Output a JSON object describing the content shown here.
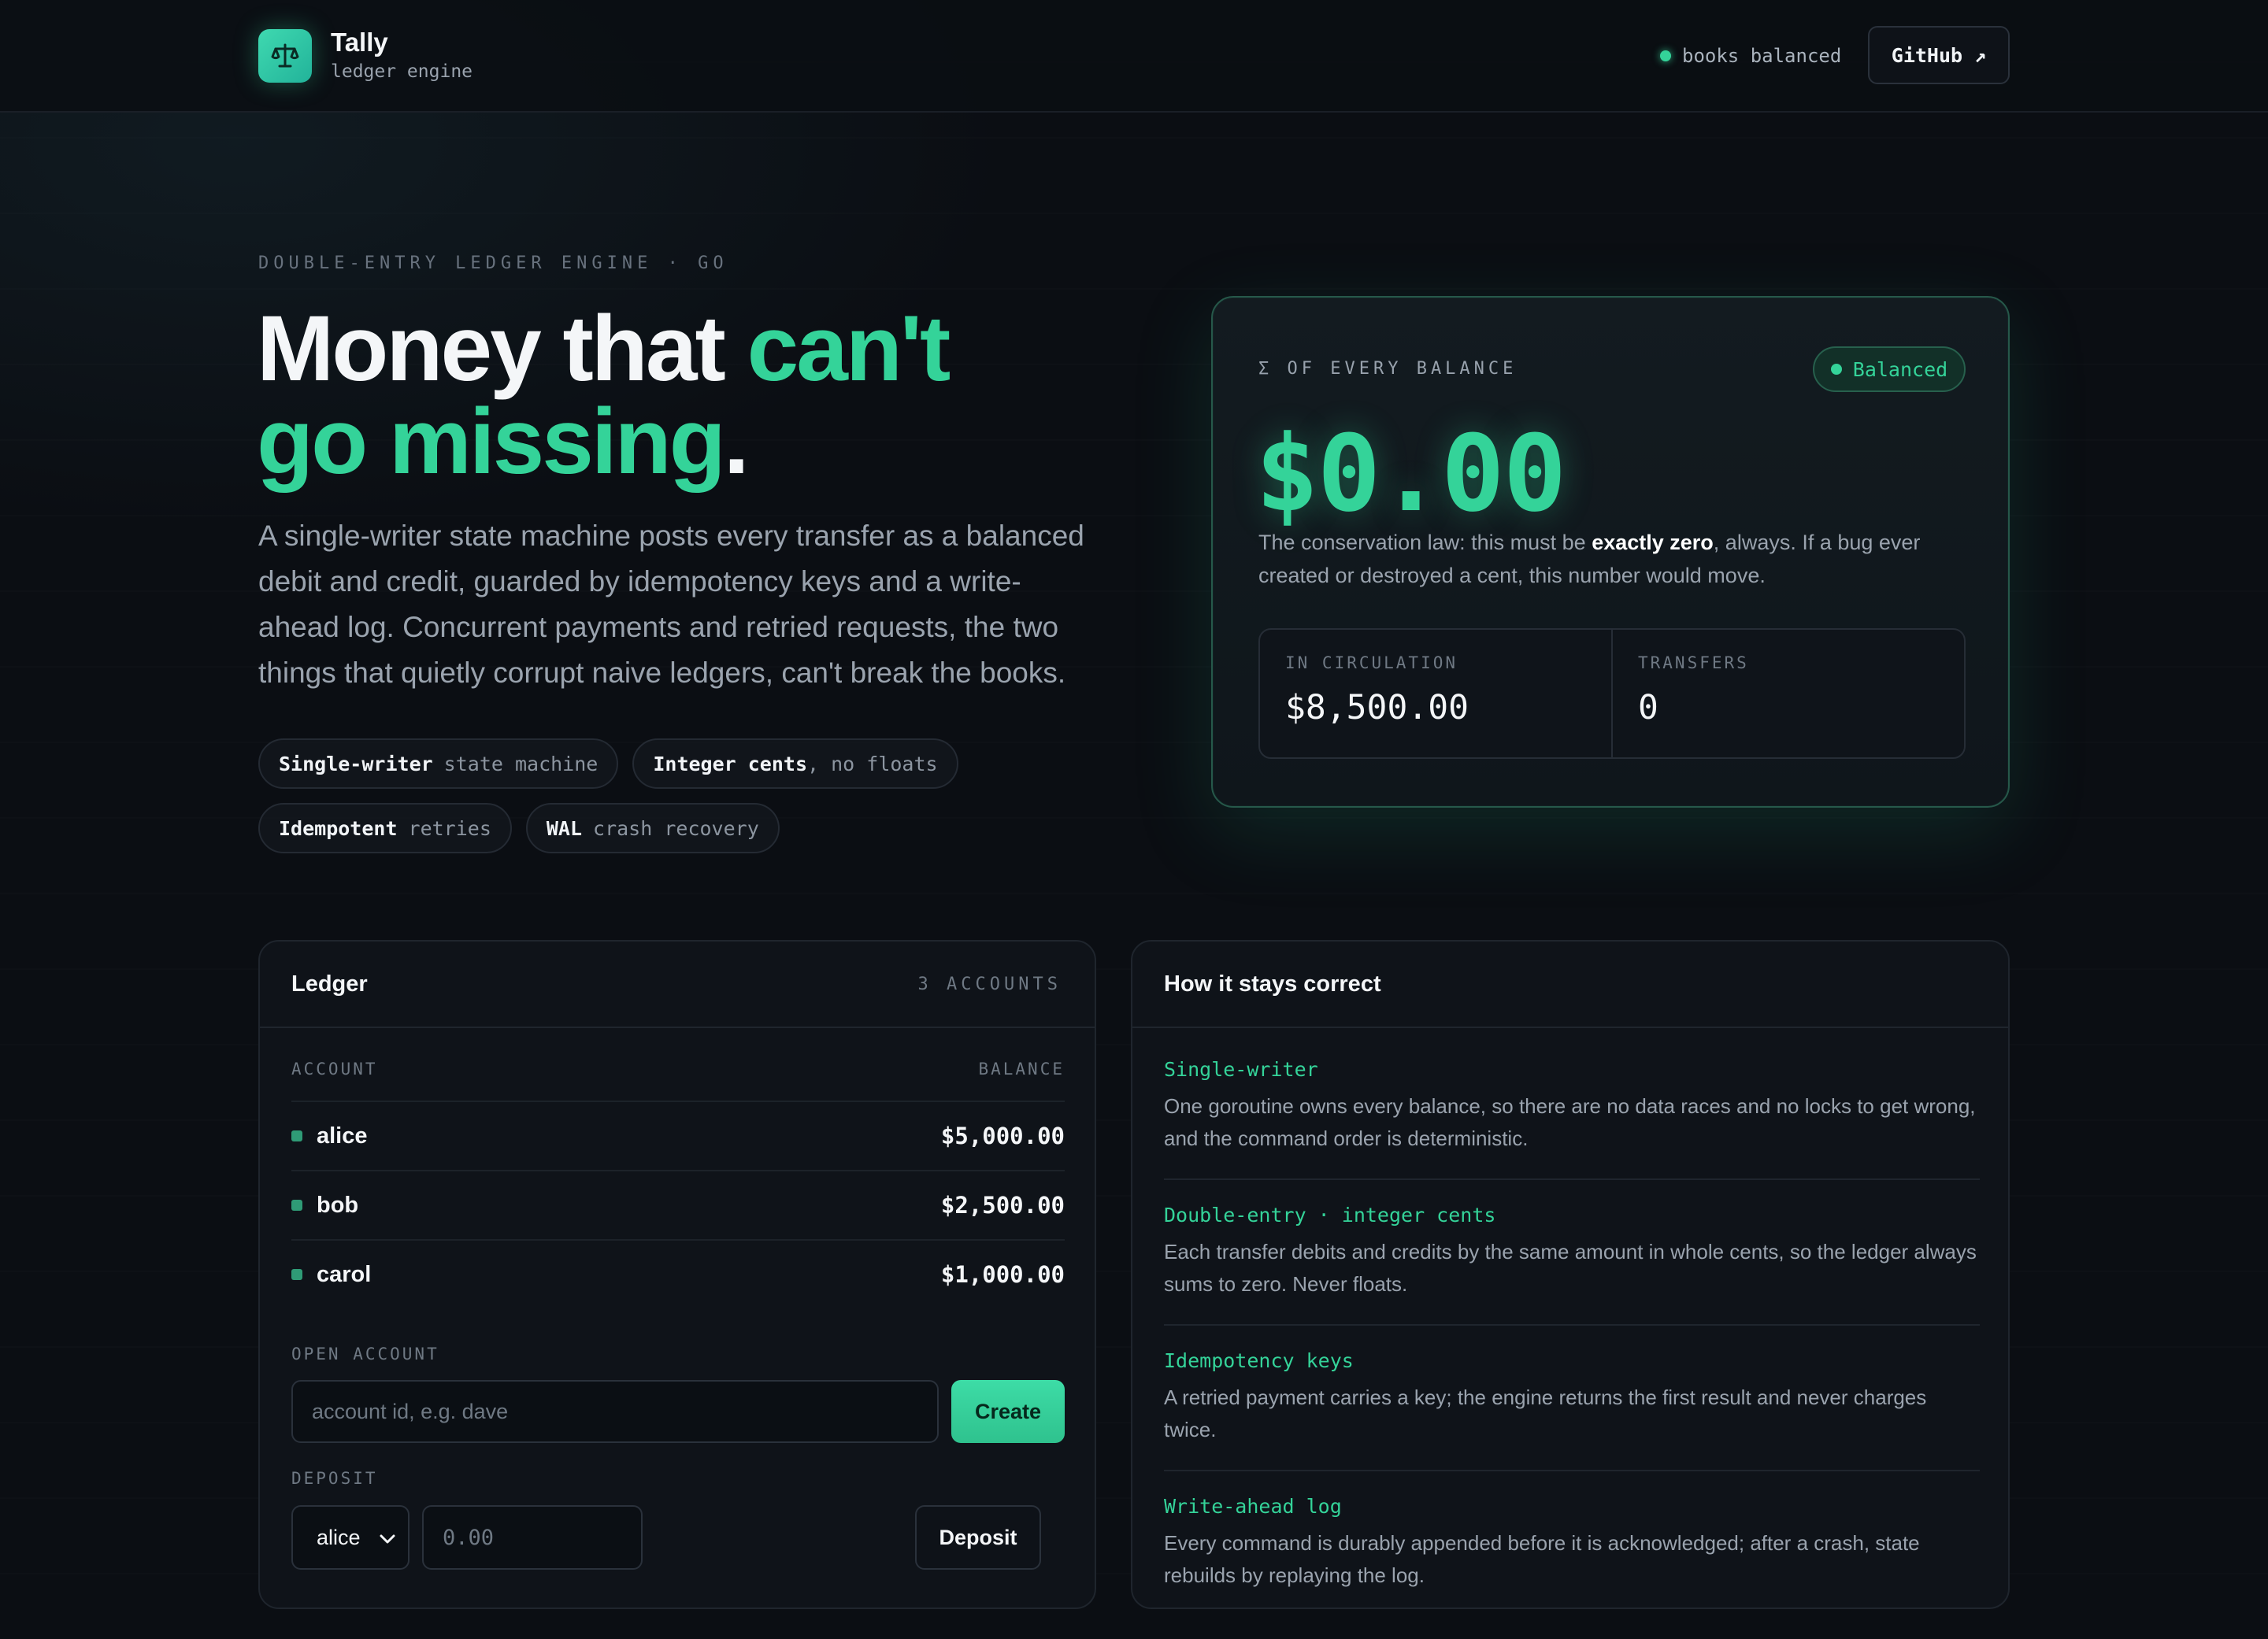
{
  "header": {
    "brand_name": "Tally",
    "brand_sub": "ledger engine",
    "status_text": "books balanced",
    "github_label": "GitHub ↗"
  },
  "hero": {
    "eyebrow": "DOUBLE-ENTRY LEDGER ENGINE · GO",
    "title_part1": "Money that ",
    "title_accent1": "can't",
    "title_accent2": "go missing",
    "title_end": ".",
    "description": "A single-writer state machine posts every transfer as a balanced debit and credit, guarded by idempotency keys and a write-ahead log. Concurrent payments and retried requests, the two things that quietly corrupt naive ledgers, can't break the books.",
    "chips": [
      {
        "bold": "Single-writer",
        "rest": "state machine"
      },
      {
        "bold": "Integer cents",
        "rest": ", no floats"
      },
      {
        "bold": "Idempotent",
        "rest": "retries"
      },
      {
        "bold": "WAL",
        "rest": "crash recovery"
      }
    ]
  },
  "balance": {
    "label": "Σ OF EVERY BALANCE",
    "badge": "Balanced",
    "amount": "$0.00",
    "note_before": "The conservation law: this must be ",
    "note_bold": "exactly zero",
    "note_after": ", always. If a bug ever created or destroyed a cent, this number would move.",
    "stats": [
      {
        "label": "IN CIRCULATION",
        "value": "$8,500.00"
      },
      {
        "label": "TRANSFERS",
        "value": "0"
      }
    ]
  },
  "ledger": {
    "title": "Ledger",
    "meta": "3 ACCOUNTS",
    "col_account": "ACCOUNT",
    "col_balance": "BALANCE",
    "rows": [
      {
        "name": "alice",
        "balance": "$5,000.00"
      },
      {
        "name": "bob",
        "balance": "$2,500.00"
      },
      {
        "name": "carol",
        "balance": "$1,000.00"
      }
    ],
    "open_label": "OPEN ACCOUNT",
    "open_placeholder": "account id, e.g. dave",
    "create_label": "Create",
    "deposit_label": "DEPOSIT",
    "deposit_account": "alice",
    "deposit_placeholder": "0.00",
    "deposit_button": "Deposit"
  },
  "howit": {
    "title": "How it stays correct",
    "rules": [
      {
        "title": "Single-writer",
        "body": "One goroutine owns every balance, so there are no data races and no locks to get wrong, and the command order is deterministic."
      },
      {
        "title": "Double-entry · integer cents",
        "body": "Each transfer debits and credits by the same amount in whole cents, so the ledger always sums to zero. Never floats."
      },
      {
        "title": "Idempotency keys",
        "body": "A retried payment carries a key; the engine returns the first result and never charges twice."
      },
      {
        "title": "Write-ahead log",
        "body": "Every command is durably appended before it is acknowledged; after a crash, state rebuilds by replaying the log."
      }
    ]
  },
  "colors": {
    "accent": "#34d399",
    "background": "#0b0e13",
    "panel": "#0f1319"
  }
}
